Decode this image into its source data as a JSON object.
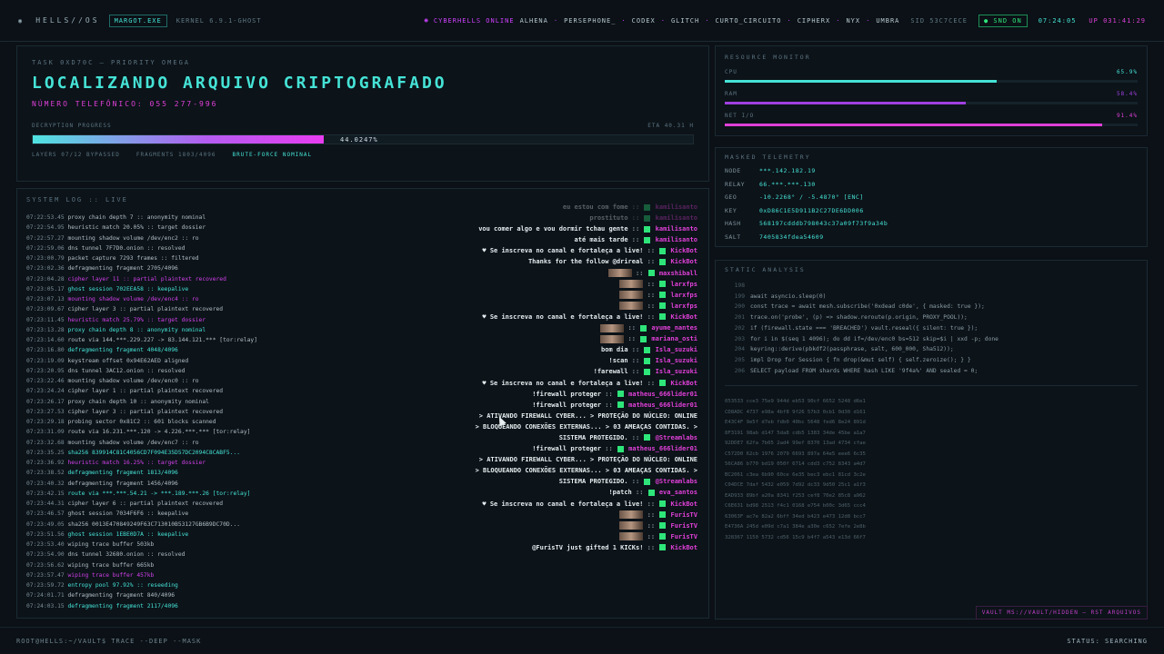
{
  "topbar": {
    "logo": "HELLS//OS",
    "proc": "MARGOT.EXE",
    "kernel": "KERNEL 6.9.1-GHOST",
    "online_label": "CYBERHELLS ONLINE",
    "users": [
      "ALHENA",
      "PERSEPHONE_",
      "CODEX",
      "GLITCH",
      "CURTO_CIRCUITO",
      "CIPHERX",
      "NYX",
      "UMBRA"
    ],
    "sid": "SID 53C7CECE",
    "sync": "SND ON",
    "clock": "07:24:05",
    "uptime": "UP 031:41:29"
  },
  "task": {
    "label": "TASK 0XD70C — PRIORITY OMEGA",
    "title": "LOCALIZANDO ARQUIVO CRIPTOGRAFADO",
    "phone": "NÚMERO TELEFÔNICO: 055 277-996",
    "progress_label": "DECRYPTION PROGRESS",
    "eta": "ETA 40.31 H",
    "progress_pct": "44.0247%",
    "progress_value": 0.440247,
    "layers": "LAYERS 07/12 BYPASSED",
    "fragments": "FRAGMENTS 1803/4096",
    "mode": "BRUTE-FORCE NOMINAL"
  },
  "log": {
    "header": "SYSTEM LOG :: LIVE",
    "lines": [
      {
        "t": "07:22:53.45",
        "m": "proxy chain depth 7 :: anonymity nominal",
        "c": "v"
      },
      {
        "t": "07:22:54.95",
        "m": "heuristic match 20.05% :: target dossier",
        "c": "v"
      },
      {
        "t": "07:22:57.27",
        "m": "mounting shadow volume /dev/enc2 :: ro",
        "c": "v"
      },
      {
        "t": "07:22:59.06",
        "m": "dns tunnel 7F7D0.onion :: resolved",
        "c": "v"
      },
      {
        "t": "07:23:00.79",
        "m": "packet capture 7293 frames :: filtered",
        "c": "v"
      },
      {
        "t": "07:23:02.36",
        "m": "defragmenting fragment 2705/4096",
        "c": "v"
      },
      {
        "t": "07:23:04.28",
        "m": "cipher layer 11 :: partial plaintext recovered",
        "c": "m"
      },
      {
        "t": "07:23:05.17",
        "m": "ghost session 702EEA58 :: keepalive",
        "c": "c"
      },
      {
        "t": "07:23:07.13",
        "m": "mounting shadow volume /dev/enc4 :: ro",
        "c": "m"
      },
      {
        "t": "07:23:09.67",
        "m": "cipher layer 3 :: partial plaintext recovered",
        "c": "v"
      },
      {
        "t": "07:23:11.45",
        "m": "heuristic match 25.79% :: target dossier",
        "c": "m"
      },
      {
        "t": "07:23:13.28",
        "m": "proxy chain depth 8 :: anonymity nominal",
        "c": "c"
      },
      {
        "t": "07:23:14.60",
        "m": "route via 144.***.229.227 -> 83.144.121.*** [tor:relay]",
        "c": "v"
      },
      {
        "t": "07:23:16.80",
        "m": "defragmenting fragment 4048/4096",
        "c": "c"
      },
      {
        "t": "07:23:19.09",
        "m": "keystream offset 0x94E62AED aligned",
        "c": "v"
      },
      {
        "t": "07:23:20.95",
        "m": "dns tunnel 3AC12.onion :: resolved",
        "c": "v"
      },
      {
        "t": "07:23:22.46",
        "m": "mounting shadow volume /dev/enc0 :: ro",
        "c": "v"
      },
      {
        "t": "07:23:24.24",
        "m": "cipher layer 1 :: partial plaintext recovered",
        "c": "v"
      },
      {
        "t": "07:23:26.17",
        "m": "proxy chain depth 10 :: anonymity nominal",
        "c": "v"
      },
      {
        "t": "07:23:27.53",
        "m": "cipher layer 3 :: partial plaintext recovered",
        "c": "v"
      },
      {
        "t": "07:23:29.18",
        "m": "probing sector 0x81C2 :: 601 blocks scanned",
        "c": "v"
      },
      {
        "t": "07:23:31.09",
        "m": "route via 16.231.***.120 -> 4.226.***.*** [tor:relay]",
        "c": "v"
      },
      {
        "t": "07:23:32.68",
        "m": "mounting shadow volume /dev/enc7 :: ro",
        "c": "v"
      },
      {
        "t": "07:23:35.25",
        "m": "sha256 839914C81C4056CD7F094E35D57DC2094C8CABF5...",
        "c": "c"
      },
      {
        "t": "07:23:36.92",
        "m": "heuristic match 16.25% :: target dossier",
        "c": "m"
      },
      {
        "t": "07:23:38.52",
        "m": "defragmenting fragment 1813/4096",
        "c": "c"
      },
      {
        "t": "07:23:40.32",
        "m": "defragmenting fragment 1456/4096",
        "c": "v"
      },
      {
        "t": "07:23:42.15",
        "m": "route via ***.***.54.21 -> ***.189.***.26 [tor:relay]",
        "c": "c"
      },
      {
        "t": "07:23:44.31",
        "m": "cipher layer 6 :: partial plaintext recovered",
        "c": "v"
      },
      {
        "t": "07:23:46.57",
        "m": "ghost session 7034F6F6 :: keepalive",
        "c": "v"
      },
      {
        "t": "07:23:49.05",
        "m": "sha256 0013E470849249F63C713010B53127GB6B9DC70D...",
        "c": "v"
      },
      {
        "t": "07:23:51.56",
        "m": "ghost session 1EBE0D7A :: keepalive",
        "c": "c"
      },
      {
        "t": "07:23:53.40",
        "m": "wiping trace buffer 503kb",
        "c": "v"
      },
      {
        "t": "07:23:54.90",
        "m": "dns tunnel 32680.onion :: resolved",
        "c": "v"
      },
      {
        "t": "07:23:56.62",
        "m": "wiping trace buffer 665kb",
        "c": "v"
      },
      {
        "t": "07:23:57.47",
        "m": "wiping trace buffer 457kb",
        "c": "m"
      },
      {
        "t": "07:23:59.72",
        "m": "entropy pool 97.92% :: reseeding",
        "c": "c"
      },
      {
        "t": "07:24:01.71",
        "m": "defragmenting fragment 840/4096",
        "c": "v"
      },
      {
        "t": "07:24:03.15",
        "m": "defragmenting fragment 2117/4096",
        "c": "c"
      }
    ]
  },
  "chat": [
    {
      "msg": "eu estou com fome",
      "user": "kamilisanto",
      "faded": true
    },
    {
      "msg": "prostituto",
      "user": "kamilisanto",
      "faded": true
    },
    {
      "msg": "vou comer algo e vou dormir tchau gente",
      "user": "kamilisanto",
      "faded": false
    },
    {
      "msg": "até mais tarde",
      "user": "kamilisanto",
      "faded": false
    },
    {
      "msg": "♥ Se inscreva no canal e fortaleça a live!",
      "user": "KickBot",
      "faded": false
    },
    {
      "msg": "Thanks for the follow @drireal",
      "user": "KickBot",
      "faded": false
    },
    {
      "msg": "",
      "user": "maxshiball",
      "faded": false
    },
    {
      "msg": "",
      "user": "larxfps",
      "faded": false
    },
    {
      "msg": "",
      "user": "larxfps",
      "faded": false
    },
    {
      "msg": "",
      "user": "larxfps",
      "faded": false
    },
    {
      "msg": "♥ Se inscreva no canal e fortaleça a live!",
      "user": "KickBot",
      "faded": false
    },
    {
      "msg": "",
      "user": "ayume_nantes",
      "faded": false
    },
    {
      "msg": "",
      "user": "mariana_osti",
      "faded": false
    },
    {
      "msg": "bom dia",
      "user": "Isla_suzuki",
      "faded": false
    },
    {
      "msg": "!scan",
      "user": "Isla_suzuki",
      "faded": false
    },
    {
      "msg": "!farewall",
      "user": "Isla_suzuki",
      "faded": false
    },
    {
      "msg": "♥ Se inscreva no canal e fortaleça a live!",
      "user": "KickBot",
      "faded": false
    },
    {
      "msg": "!firewall proteger",
      "user": "matheus_666lider01",
      "faded": false
    },
    {
      "msg": "!firewall proteger",
      "user": "matheus_666lider01",
      "faded": false
    },
    {
      "msg": "> ATIVANDO FIREWALL CYBER... > PROTEÇÃO DO NÚCLEO: ONLINE",
      "user": "",
      "faded": false
    },
    {
      "msg": "> BLOQUEANDO CONEXÕES EXTERNAS... > 03 AMEAÇAS CONTIDAS. >",
      "user": "",
      "faded": false
    },
    {
      "msg": "SISTEMA PROTEGIDO.",
      "user": "@Streamlabs",
      "faded": false
    },
    {
      "msg": "!firewall proteger",
      "user": "matheus_666lider01",
      "faded": false
    },
    {
      "msg": "> ATIVANDO FIREWALL CYBER... > PROTEÇÃO DO NÚCLEO: ONLINE",
      "user": "",
      "faded": false
    },
    {
      "msg": "> BLOQUEANDO CONEXÕES EXTERNAS... > 03 AMEAÇAS CONTIDAS. >",
      "user": "",
      "faded": false
    },
    {
      "msg": "SISTEMA PROTEGIDO.",
      "user": "@Streamlabs",
      "faded": false
    },
    {
      "msg": "!patch",
      "user": "eva_santos",
      "faded": false
    },
    {
      "msg": "♥ Se inscreva no canal e fortaleça a live!",
      "user": "KickBot",
      "faded": false
    },
    {
      "msg": "",
      "user": "FurisTV",
      "faded": false
    },
    {
      "msg": "",
      "user": "FurisTV",
      "faded": false
    },
    {
      "msg": "",
      "user": "FurisTV",
      "faded": false
    },
    {
      "msg": "@FurisTV just gifted 1 KICKs!",
      "user": "KickBot",
      "faded": false
    }
  ],
  "resources": {
    "title": "RESOURCE MONITOR",
    "items": [
      {
        "name": "CPU",
        "value": "65.9%",
        "frac": 0.659,
        "color": "#45e3d6"
      },
      {
        "name": "RAM",
        "value": "58.4%",
        "frac": 0.584,
        "color": "#a040e0"
      },
      {
        "name": "NET I/O",
        "value": "91.4%",
        "frac": 0.914,
        "color": "#e040d8"
      }
    ]
  },
  "telemetry": {
    "title": "MASKED TELEMETRY",
    "rows": [
      {
        "k": "NODE",
        "v": "***.142.182.19"
      },
      {
        "k": "RELAY",
        "v": "66.***.***.130"
      },
      {
        "k": "GEO",
        "v": "-10.2268° / -5.4870° [ENC]"
      },
      {
        "k": "KEY",
        "v": "0xD86C1E5D911B2C27DE6DD006"
      },
      {
        "k": "HASH",
        "v": "568197cdddb798043c37a09f73f9a34b"
      },
      {
        "k": "SALT",
        "v": "7405834fdea54609"
      }
    ]
  },
  "analysis": {
    "title": "STATIC ANALYSIS",
    "code": [
      {
        "n": "198",
        "c": ""
      },
      {
        "n": "199",
        "c": "await asyncio.sleep(0)"
      },
      {
        "n": "200",
        "c": "const trace = await mesh.subscribe('0xdead c0de', { masked: true });"
      },
      {
        "n": "201",
        "c": "trace.on('probe', (p) => shadow.reroute(p.origin, PROXY_POOL));"
      },
      {
        "n": "202",
        "c": "if (firewall.state === 'BREACHED') vault.reseal({ silent: true });"
      },
      {
        "n": "203",
        "c": "for i in $(seq 1 4096); do dd if=/dev/enc0 bs=512 skip=$i | xxd -p; done"
      },
      {
        "n": "204",
        "c": "keyring::derive(pbkdf2(passphrase, salt, 600_000, Sha512));"
      },
      {
        "n": "205",
        "c": "impl Drop for Session { fn drop(&mut self) { self.zeroize(); } }"
      },
      {
        "n": "206",
        "c": "SELECT payload FROM shards WHERE hash LIKE '9f4a%' AND sealed = 0;"
      }
    ],
    "hex": [
      "053533 cce3 75e9 944d eb53 90cf 6652 5248 d6e1",
      "CD8ADC 4737 e98a 4bf8 9f26 57b3 0cb1 0d30 d161",
      "E43C4F 9e5f d7eb fdb0 40bc 5648 fed6 8e24 891d",
      "8F3191 98ab d147 5da8 cdb5 1383 34de 45be a1a7",
      "92DDE7 62fa 7b05 2ad4 99ef 8370 13ad 4734 cfae",
      "C572D0 62cb 1976 2079 6693 897a 64e5 eee6 6c35",
      "56CA86 b770 bd19 050f 6714 cdd3 c752 8343 a4d7",
      "BC2061 c3ea 6b90 60ce 6e35 bec3 ebc1 81cd 3c2e",
      "C04DCE 7daf 5432 e059 7d92 dc33 9d50 25c1 a1f3",
      "EAD933 89bf a20a 8341 f253 cef8 70e2 85c8 a962",
      "C6E631 bd98 2513 f4c1 0168 e754 b00c 3d65 ccc4",
      "63063F ac7e 82a2 6bff 34ed b423 e473 12d8 bcc7",
      "E4736A 245d e09d c7a1 384e a30e c652 7efe 2e8b",
      "328367 1150 5732 cd56 15c9 b4f7 a543 e13d 66f7"
    ]
  },
  "vault": "VAULT MS://VAULT/HIDDEN — RST ARQUIVOS",
  "footer": {
    "prompt": "ROOT@HELLS:~/VAULT$ TRACE --DEEP --MASK",
    "status": "STATUS: SEARCHING"
  }
}
